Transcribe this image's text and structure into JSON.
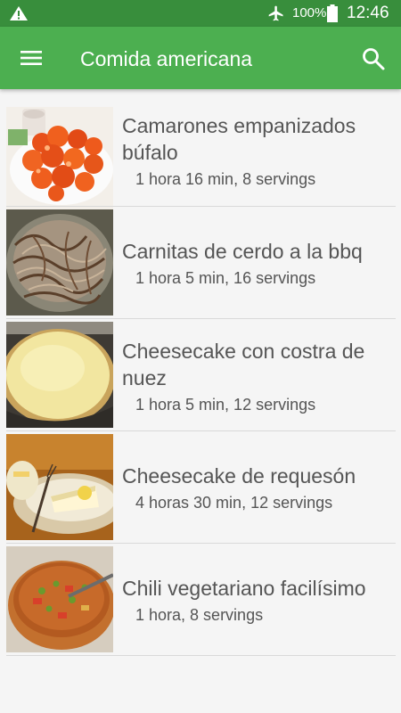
{
  "status_bar": {
    "battery_percent": "100%",
    "time": "12:46",
    "icons": [
      "warning-icon",
      "airplane-mode-icon",
      "battery-icon"
    ]
  },
  "app_bar": {
    "title": "Comida americana",
    "icons": [
      "menu-icon",
      "search-icon"
    ]
  },
  "recipes": [
    {
      "title_line1": "Camarones empanizados",
      "title_line2": "búfalo",
      "meta": "1 hora 16 min, 8 servings"
    },
    {
      "title_line1": "Carnitas de cerdo a la bbq",
      "title_line2": "",
      "meta": "1 hora 5 min, 16 servings"
    },
    {
      "title_line1": "Cheesecake con costra de",
      "title_line2": "nuez",
      "meta": "1 hora 5 min, 12 servings"
    },
    {
      "title_line1": "Cheesecake de requesón",
      "title_line2": "",
      "meta": "4 horas 30 min, 12 servings"
    },
    {
      "title_line1": "Chili vegetariano facilísimo",
      "title_line2": "",
      "meta": "1 hora, 8 servings"
    }
  ],
  "colors": {
    "status_bar": "#388e3c",
    "app_bar": "#4caf50",
    "background": "#f5f5f5",
    "text": "#555555"
  }
}
